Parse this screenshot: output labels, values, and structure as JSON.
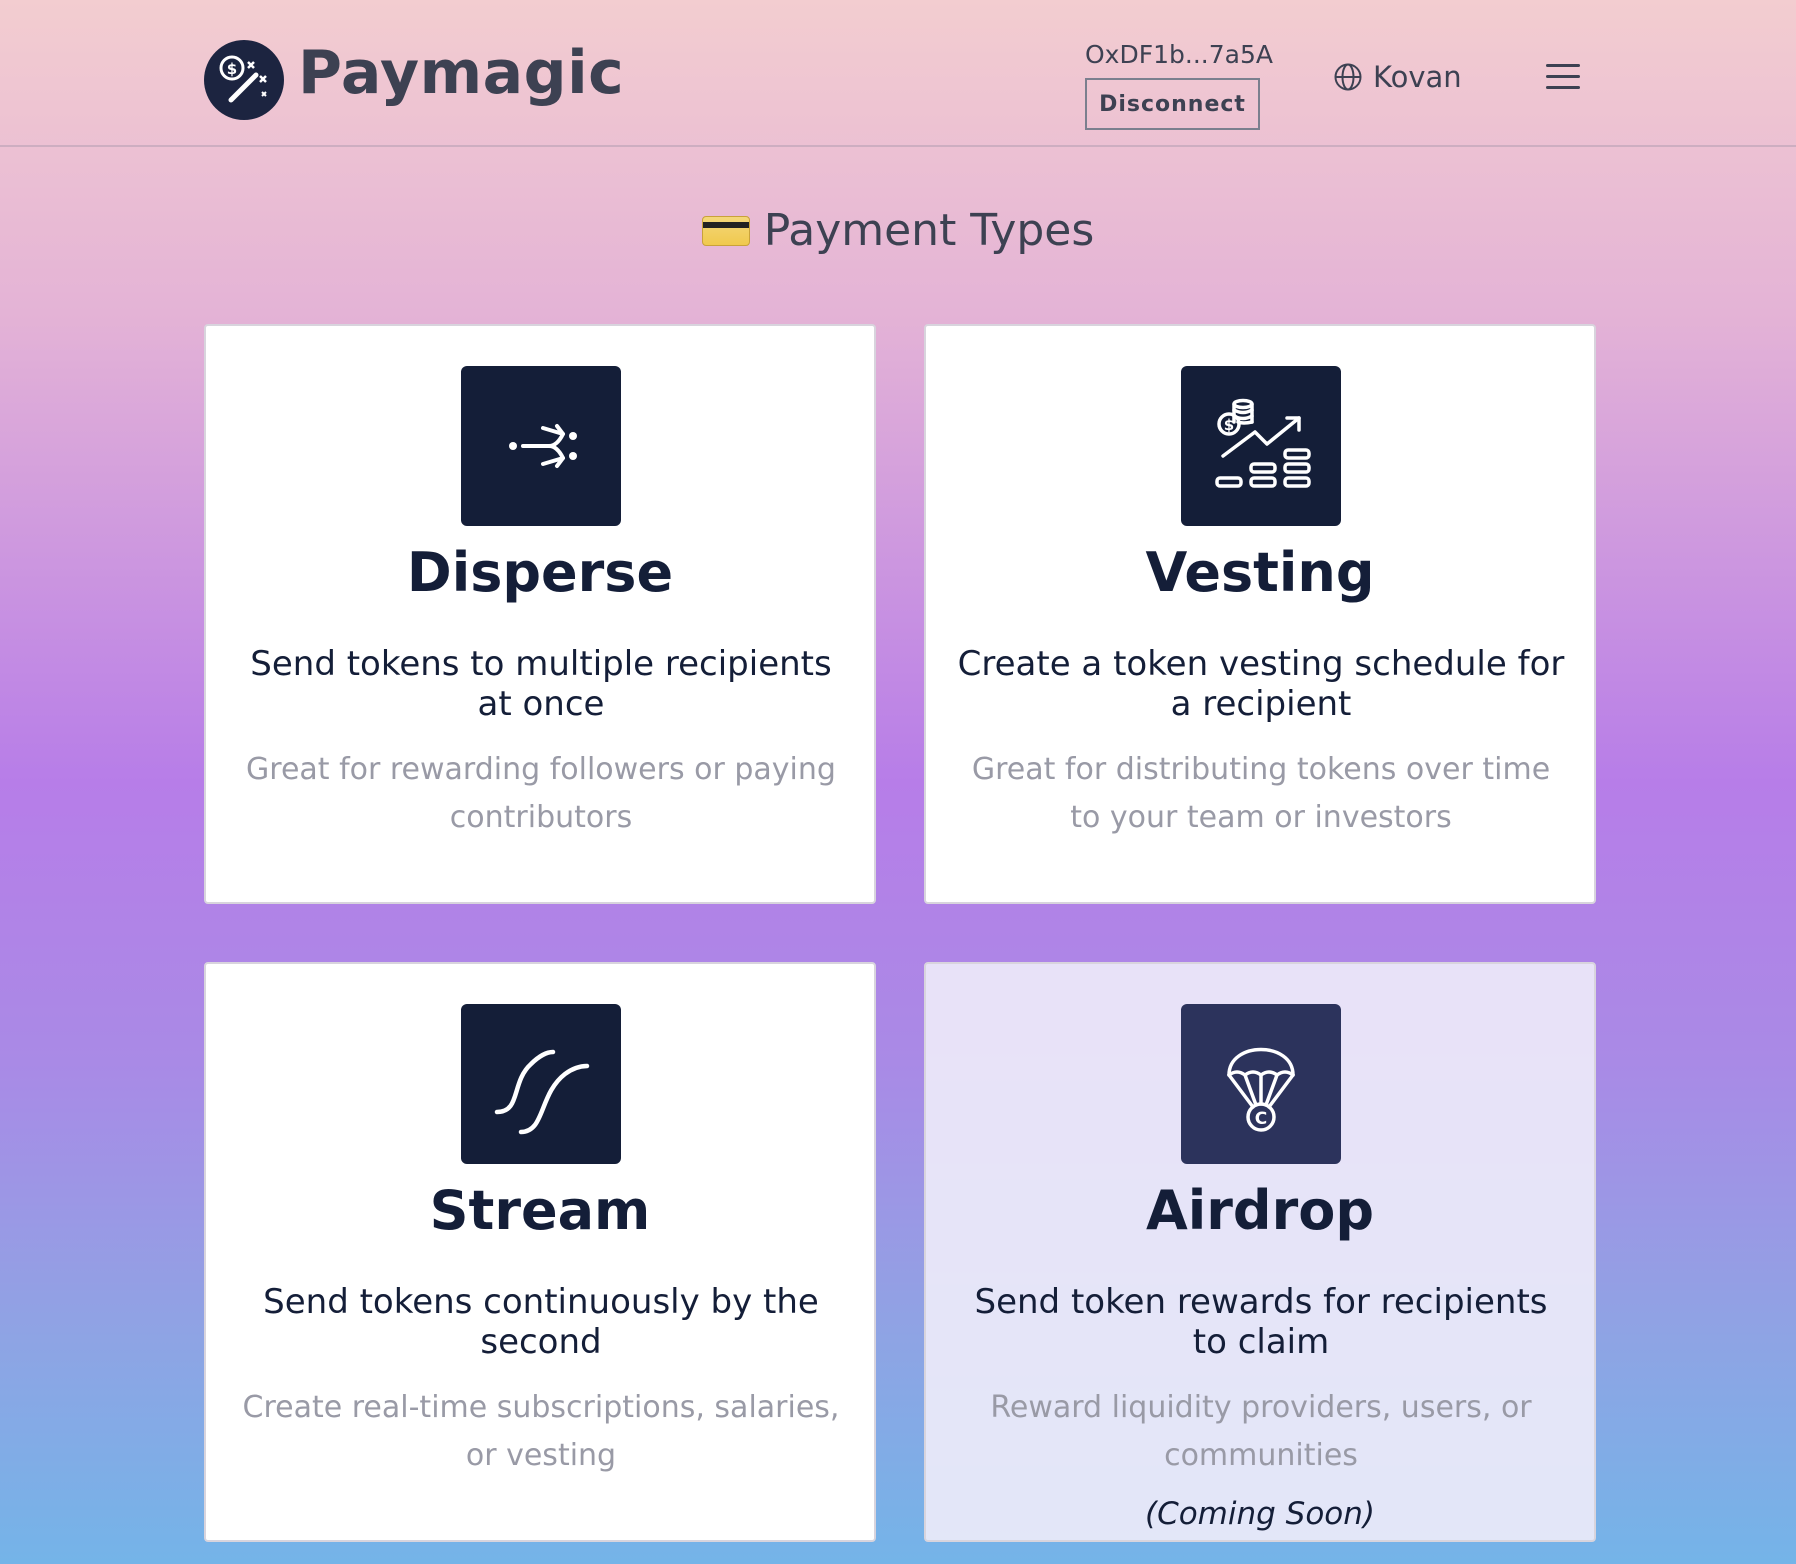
{
  "header": {
    "brand": "Paymagic",
    "wallet_address": "OxDF1b...7a5A",
    "disconnect_label": "Disconnect",
    "network": "Kovan"
  },
  "section": {
    "title": "Payment Types",
    "title_icon": "credit-card-icon"
  },
  "cards": [
    {
      "title": "Disperse",
      "icon": "disperse-arrows-icon",
      "description": "Send tokens to multiple recipients at once",
      "note": "Great for rewarding followers or paying contributors",
      "coming_soon": ""
    },
    {
      "title": "Vesting",
      "icon": "vesting-chart-icon",
      "description": "Create a token vesting schedule for a recipient",
      "note": "Great for distributing tokens over time to your team or investors",
      "coming_soon": ""
    },
    {
      "title": "Stream",
      "icon": "stream-waves-icon",
      "description": "Send tokens continuously by the second",
      "note": "Create real-time subscriptions, salaries, or vesting",
      "coming_soon": ""
    },
    {
      "title": "Airdrop",
      "icon": "parachute-coin-icon",
      "description": "Send token rewards for recipients to claim",
      "note": "Reward liquidity providers, users, or communities",
      "coming_soon": "(Coming Soon)"
    }
  ],
  "colors": {
    "tile": "#141e38",
    "tile_disabled": "#2c335c",
    "text_primary": "#141e38",
    "text_muted": "#999aa6"
  }
}
